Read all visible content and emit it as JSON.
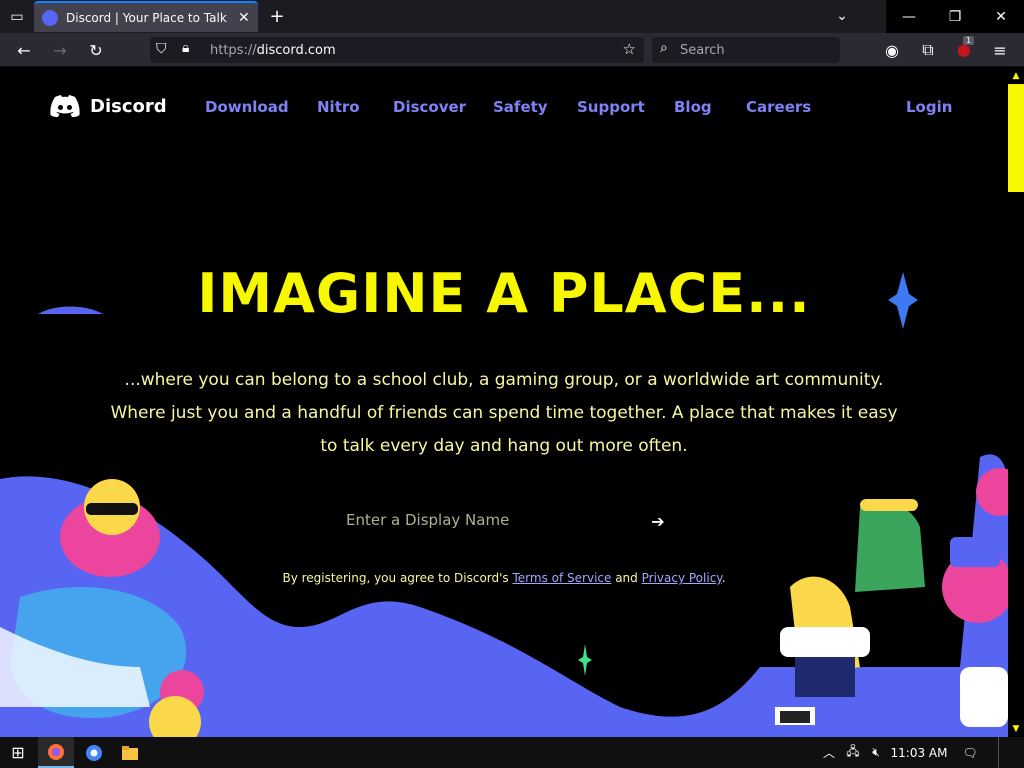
{
  "browser": {
    "tab_title": "Discord | Your Place to Talk and Hang Out",
    "tab_close": "✕",
    "new_tab": "+",
    "url_protocol": "https://",
    "url_domain": "discord.com",
    "search_placeholder": "Search",
    "extension_badge": "1",
    "window_minimize": "—",
    "window_restore": "❐",
    "window_close": "✕"
  },
  "site": {
    "logo_text": "Discord",
    "nav": [
      "Download",
      "Nitro",
      "Discover",
      "Safety",
      "Support",
      "Blog",
      "Careers"
    ],
    "login": "Login",
    "hero_title": "IMAGINE A PLACE...",
    "hero_subtitle": "...where you can belong to a school club, a gaming group, or a worldwide art community. Where just you and a handful of friends can spend time together. A place that makes it easy to talk every day and hang out more often.",
    "display_name_placeholder": "Enter a Display Name",
    "legal_prefix": "By registering, you agree to Discord's ",
    "terms_link": "Terms of Service",
    "legal_and": " and ",
    "privacy_link": "Privacy Policy",
    "legal_suffix": "."
  },
  "taskbar": {
    "clock": "11:03 AM"
  },
  "colors": {
    "accent_yellow": "#f7f700",
    "nav_link": "#7d82f5",
    "blurple": "#5865f2",
    "browser_accent": "#0a84ff"
  }
}
